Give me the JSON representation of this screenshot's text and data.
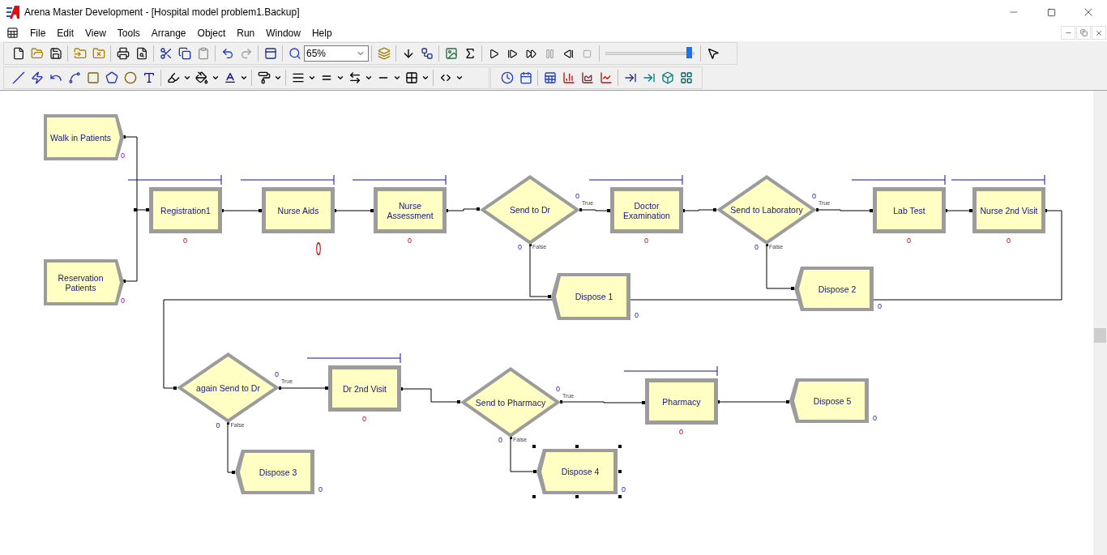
{
  "window": {
    "title": "Arena Master Development - [Hospital model problem1.Backup]"
  },
  "menu": [
    "File",
    "Edit",
    "View",
    "Tools",
    "Arrange",
    "Object",
    "Run",
    "Window",
    "Help"
  ],
  "toolbar": {
    "zoom": "65%",
    "speed": {
      "level": 0.97
    }
  },
  "diagram": {
    "nodes": [
      {
        "kind": "create",
        "label": "Walk in Patients",
        "counter": "0",
        "selected": false
      },
      {
        "kind": "process",
        "label": "Registration1",
        "counter": "0",
        "counter_large": false,
        "selected": false
      },
      {
        "kind": "process",
        "label": "Nurse Aids",
        "counter": "0",
        "counter_large": true,
        "selected": false
      },
      {
        "kind": "process",
        "label": "Nurse Assessment",
        "counter": "0",
        "counter_large": false,
        "selected": false
      },
      {
        "kind": "decide",
        "label": "Send to Dr",
        "true_count": "0",
        "true_label": "True",
        "false_count": "0",
        "false_label": "False",
        "selected": false
      },
      {
        "kind": "process",
        "label": "Doctor Examination",
        "counter": "0",
        "counter_large": false,
        "selected": false
      },
      {
        "kind": "decide",
        "label": "Send to Laboratory",
        "true_count": "0",
        "true_label": "True",
        "false_count": "0",
        "false_label": "False",
        "selected": false
      },
      {
        "kind": "process",
        "label": "Lab Test",
        "counter": "0",
        "counter_large": false,
        "selected": false
      },
      {
        "kind": "process",
        "label": "Nurse 2nd Visit",
        "counter": "0",
        "counter_large": false,
        "selected": false
      },
      {
        "kind": "create",
        "label": "Reservation Patients",
        "counter": "0",
        "selected": false
      },
      {
        "kind": "dispose",
        "label": "Dispose 1",
        "counter": "0",
        "selected": false
      },
      {
        "kind": "dispose",
        "label": "Dispose 2",
        "counter": "0",
        "selected": false
      },
      {
        "kind": "decide",
        "label": "again Send to Dr",
        "true_count": "0",
        "true_label": "True",
        "false_count": "0",
        "false_label": "False",
        "selected": false
      },
      {
        "kind": "process",
        "label": "Dr 2nd Visit",
        "counter": "0",
        "counter_large": false,
        "selected": false
      },
      {
        "kind": "decide",
        "label": "Send to Pharmacy",
        "true_count": "0",
        "true_label": "True",
        "false_count": "0",
        "false_label": "False",
        "selected": false
      },
      {
        "kind": "process",
        "label": "Pharmacy",
        "counter": "0",
        "counter_large": false,
        "selected": false
      },
      {
        "kind": "dispose",
        "label": "Dispose 5",
        "counter": "0",
        "selected": false
      },
      {
        "kind": "dispose",
        "label": "Dispose 3",
        "counter": "0",
        "selected": false
      },
      {
        "kind": "dispose",
        "label": "Dispose 4",
        "counter": "0",
        "selected": true
      }
    ]
  }
}
